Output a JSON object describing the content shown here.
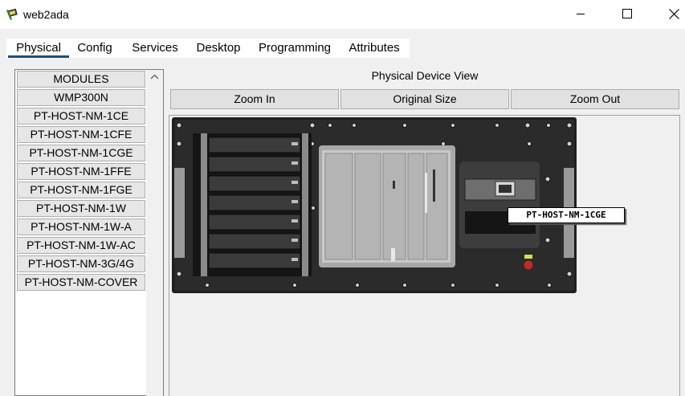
{
  "window": {
    "title": "web2ada"
  },
  "tabs": [
    "Physical",
    "Config",
    "Services",
    "Desktop",
    "Programming",
    "Attributes"
  ],
  "modules": [
    "MODULES",
    "WMP300N",
    "PT-HOST-NM-1CE",
    "PT-HOST-NM-1CFE",
    "PT-HOST-NM-1CGE",
    "PT-HOST-NM-1FFE",
    "PT-HOST-NM-1FGE",
    "PT-HOST-NM-1W",
    "PT-HOST-NM-1W-A",
    "PT-HOST-NM-1W-AC",
    "PT-HOST-NM-3G/4G",
    "PT-HOST-NM-COVER"
  ],
  "view": {
    "label": "Physical Device View",
    "zoom_in": "Zoom In",
    "original_size": "Original Size",
    "zoom_out": "Zoom Out"
  },
  "tooltip": "PT-HOST-NM-1CGE"
}
